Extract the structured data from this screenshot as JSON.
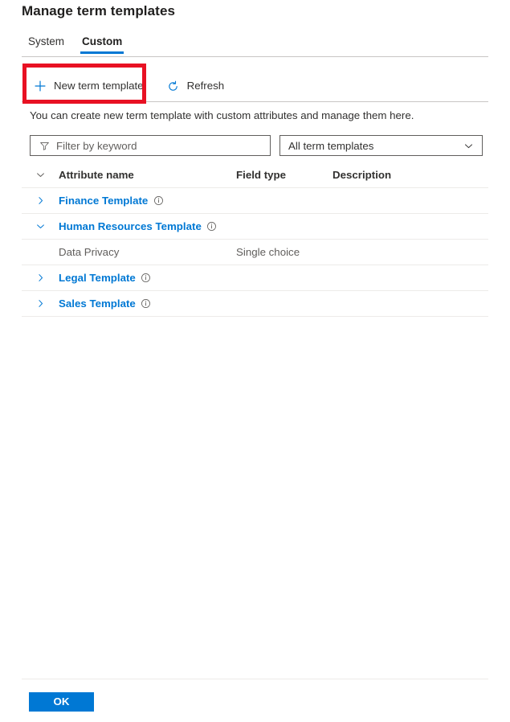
{
  "page": {
    "title": "Manage term templates"
  },
  "tabs": [
    {
      "label": "System",
      "selected": false
    },
    {
      "label": "Custom",
      "selected": true
    }
  ],
  "commandbar": {
    "new_template": {
      "label": "New term template",
      "icon": "plus-icon"
    },
    "refresh": {
      "label": "Refresh",
      "icon": "refresh-icon"
    }
  },
  "highlight": {
    "color": "#e81123",
    "target": "New term template"
  },
  "description": "You can create new term template with custom attributes and manage them here.",
  "filters": {
    "search": {
      "value": "",
      "placeholder": "Filter by keyword",
      "icon": "filter-icon"
    },
    "template_dropdown": {
      "value": "All term templates",
      "icon": "chevron-down-icon"
    }
  },
  "table": {
    "columns": [
      "Attribute name",
      "Field type",
      "Description"
    ],
    "header_chevron": "chevron-down-icon",
    "rows": [
      {
        "type": "template",
        "chevron": "chevron-right-icon",
        "expanded": false,
        "name": "Finance Template",
        "info": "info-icon",
        "field_type": "",
        "description": ""
      },
      {
        "type": "template",
        "chevron": "chevron-down-icon",
        "expanded": true,
        "name": "Human Resources Template",
        "info": "info-icon",
        "field_type": "",
        "description": ""
      },
      {
        "type": "attribute",
        "chevron": "",
        "expanded": false,
        "name": "Data Privacy",
        "info": "",
        "field_type": "Single choice",
        "description": ""
      },
      {
        "type": "template",
        "chevron": "chevron-right-icon",
        "expanded": false,
        "name": "Legal Template",
        "info": "info-icon",
        "field_type": "",
        "description": ""
      },
      {
        "type": "template",
        "chevron": "chevron-right-icon",
        "expanded": false,
        "name": "Sales Template",
        "info": "info-icon",
        "field_type": "",
        "description": ""
      }
    ]
  },
  "footer": {
    "ok_label": "OK",
    "accent_color": "#0078d4"
  }
}
